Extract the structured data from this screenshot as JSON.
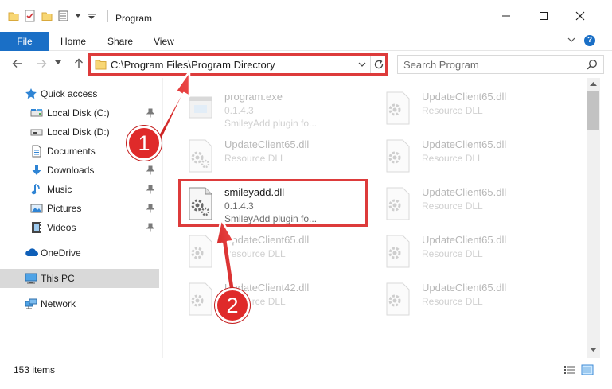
{
  "window": {
    "title": "Program"
  },
  "ribbon": {
    "tabs": [
      {
        "label": "File"
      },
      {
        "label": "Share"
      },
      {
        "label": "View"
      },
      {
        "label": "Home"
      }
    ]
  },
  "navbar": {
    "address": "C:\\Program Files\\Program Directory",
    "search_placeholder": "Search Program"
  },
  "sidebar": {
    "items": [
      {
        "label": "Quick access",
        "icon": "star-icon",
        "pinned": false
      },
      {
        "label": "Local Disk (C:)",
        "icon": "drive-icon",
        "pinned": true
      },
      {
        "label": "Local Disk (D:)",
        "icon": "drive-icon",
        "pinned": true
      },
      {
        "label": "Documents",
        "icon": "document-icon",
        "pinned": true
      },
      {
        "label": "Downloads",
        "icon": "download-arrow-icon",
        "pinned": true
      },
      {
        "label": "Music",
        "icon": "music-note-icon",
        "pinned": true
      },
      {
        "label": "Pictures",
        "icon": "picture-icon",
        "pinned": true
      },
      {
        "label": "Videos",
        "icon": "film-icon",
        "pinned": true
      },
      {
        "label": "OneDrive",
        "icon": "cloud-icon",
        "pinned": false
      },
      {
        "label": "This PC",
        "icon": "monitor-icon",
        "pinned": false
      },
      {
        "label": "Network",
        "icon": "network-icon",
        "pinned": false
      }
    ]
  },
  "files": [
    {
      "name": "program.exe",
      "line2": "0.1.4.3",
      "line3": "SmileyAdd plugin fo...",
      "icon": "exe-icon",
      "highlighted": false
    },
    {
      "name": "UpdateClient65.dll",
      "line2": "Resource DLL",
      "line3": "",
      "icon": "dll-gear-icon",
      "highlighted": false
    },
    {
      "name": "UpdateClient65.dll",
      "line2": "Resource DLL",
      "line3": "",
      "icon": "dll-gear-icon",
      "highlighted": false
    },
    {
      "name": "UpdateClient65.dll",
      "line2": "Resource DLL",
      "line3": "",
      "icon": "dll-gear-icon",
      "highlighted": false
    },
    {
      "name": "smileyadd.dll",
      "line2": "0.1.4.3",
      "line3": "SmileyAdd plugin fo...",
      "icon": "dll-gear-icon",
      "highlighted": true
    },
    {
      "name": "UpdateClient65.dll",
      "line2": "Resource DLL",
      "line3": "",
      "icon": "dll-gear-icon",
      "highlighted": false
    },
    {
      "name": "UpdateClient65.dll",
      "line2": "Resource DLL",
      "line3": "",
      "icon": "dll-gear-icon",
      "highlighted": false
    },
    {
      "name": "UpdateClient65.dll",
      "line2": "Resource DLL",
      "line3": "",
      "icon": "dll-gear-icon",
      "highlighted": false
    },
    {
      "name": "UpdateClient42.dll",
      "line2": "Resource DLL",
      "line3": "",
      "icon": "dll-gear-icon",
      "highlighted": false
    },
    {
      "name": "UpdateClient65.dll",
      "line2": "Resource DLL",
      "line3": "",
      "icon": "dll-gear-icon",
      "highlighted": false
    }
  ],
  "status": {
    "item_count": "153 items"
  },
  "annotations": {
    "step1": "1",
    "step2": "2"
  },
  "colors": {
    "accent": "#1a6fc6",
    "highlight": "#dd3b3b",
    "badge": "#df2a2a",
    "selection": "#cce8ff"
  }
}
